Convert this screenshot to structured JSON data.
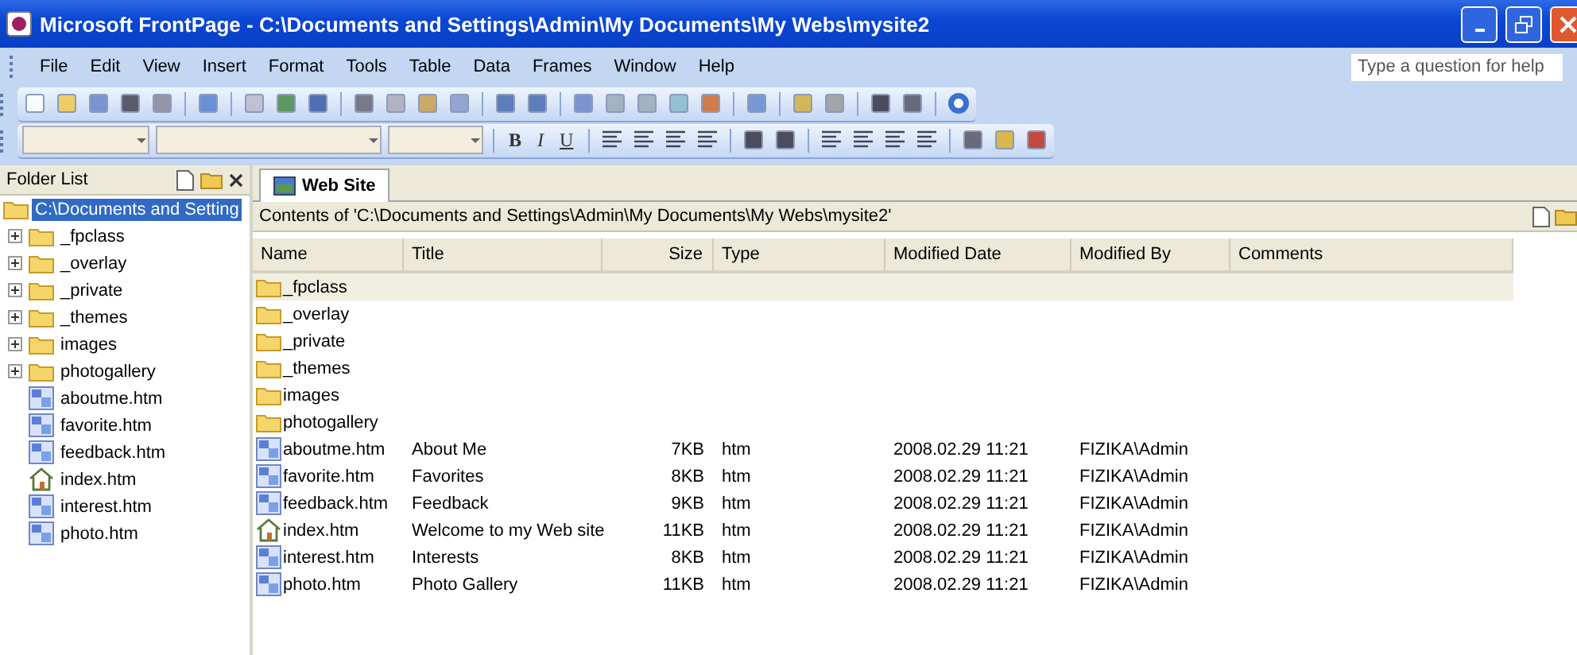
{
  "window": {
    "title": "Microsoft FrontPage - C:\\Documents and Settings\\Admin\\My Documents\\My Webs\\mysite2"
  },
  "menu": [
    "File",
    "Edit",
    "View",
    "Insert",
    "Format",
    "Tools",
    "Table",
    "Data",
    "Frames",
    "Window",
    "Help"
  ],
  "help_box": {
    "placeholder": "Type a question for help"
  },
  "format_buttons": [
    "B",
    "I",
    "U"
  ],
  "folder_list": {
    "title": "Folder List",
    "root": {
      "label": "C:\\Documents and Setting",
      "selected": true
    },
    "items": [
      {
        "kind": "folder",
        "label": "_fpclass",
        "expanded": false
      },
      {
        "kind": "folder",
        "label": "_overlay",
        "expanded": false
      },
      {
        "kind": "folder",
        "label": "_private",
        "expanded": false
      },
      {
        "kind": "folder",
        "label": "_themes",
        "expanded": false
      },
      {
        "kind": "folder",
        "label": "images",
        "expanded": false
      },
      {
        "kind": "folder",
        "label": "photogallery",
        "expanded": false
      },
      {
        "kind": "page",
        "label": "aboutme.htm"
      },
      {
        "kind": "page",
        "label": "favorite.htm"
      },
      {
        "kind": "page",
        "label": "feedback.htm"
      },
      {
        "kind": "home",
        "label": "index.htm"
      },
      {
        "kind": "page",
        "label": "interest.htm"
      },
      {
        "kind": "page",
        "label": "photo.htm"
      }
    ]
  },
  "tab": {
    "label": "Web Site",
    "selected": true
  },
  "contents_path": "Contents of 'C:\\Documents and Settings\\Admin\\My Documents\\My Webs\\mysite2'",
  "table": {
    "columns": [
      "Name",
      "Title",
      "Size",
      "Type",
      "Modified Date",
      "Modified By",
      "Comments"
    ],
    "rows": [
      {
        "kind": "folder",
        "name": "_fpclass",
        "selected": true
      },
      {
        "kind": "folder",
        "name": "_overlay",
        "selected": false
      },
      {
        "kind": "folder",
        "name": "_private",
        "selected": false
      },
      {
        "kind": "folder",
        "name": "_themes",
        "selected": false
      },
      {
        "kind": "folder",
        "name": "images",
        "selected": false
      },
      {
        "kind": "folder",
        "name": "photogallery",
        "selected": false
      },
      {
        "kind": "page",
        "name": "aboutme.htm",
        "title": "About Me",
        "size": "7KB",
        "type": "htm",
        "date": "2008.02.29 11:21",
        "by": "FIZIKA\\Admin",
        "selected": false
      },
      {
        "kind": "page",
        "name": "favorite.htm",
        "title": "Favorites",
        "size": "8KB",
        "type": "htm",
        "date": "2008.02.29 11:21",
        "by": "FIZIKA\\Admin",
        "selected": false
      },
      {
        "kind": "page",
        "name": "feedback.htm",
        "title": "Feedback",
        "size": "9KB",
        "type": "htm",
        "date": "2008.02.29 11:21",
        "by": "FIZIKA\\Admin",
        "selected": false
      },
      {
        "kind": "home",
        "name": "index.htm",
        "title": "Welcome to my Web site",
        "size": "11KB",
        "type": "htm",
        "date": "2008.02.29 11:21",
        "by": "FIZIKA\\Admin",
        "selected": false
      },
      {
        "kind": "page",
        "name": "interest.htm",
        "title": "Interests",
        "size": "8KB",
        "type": "htm",
        "date": "2008.02.29 11:21",
        "by": "FIZIKA\\Admin",
        "selected": false
      },
      {
        "kind": "page",
        "name": "photo.htm",
        "title": "Photo Gallery",
        "size": "11KB",
        "type": "htm",
        "date": "2008.02.29 11:21",
        "by": "FIZIKA\\Admin",
        "selected": false
      }
    ]
  }
}
